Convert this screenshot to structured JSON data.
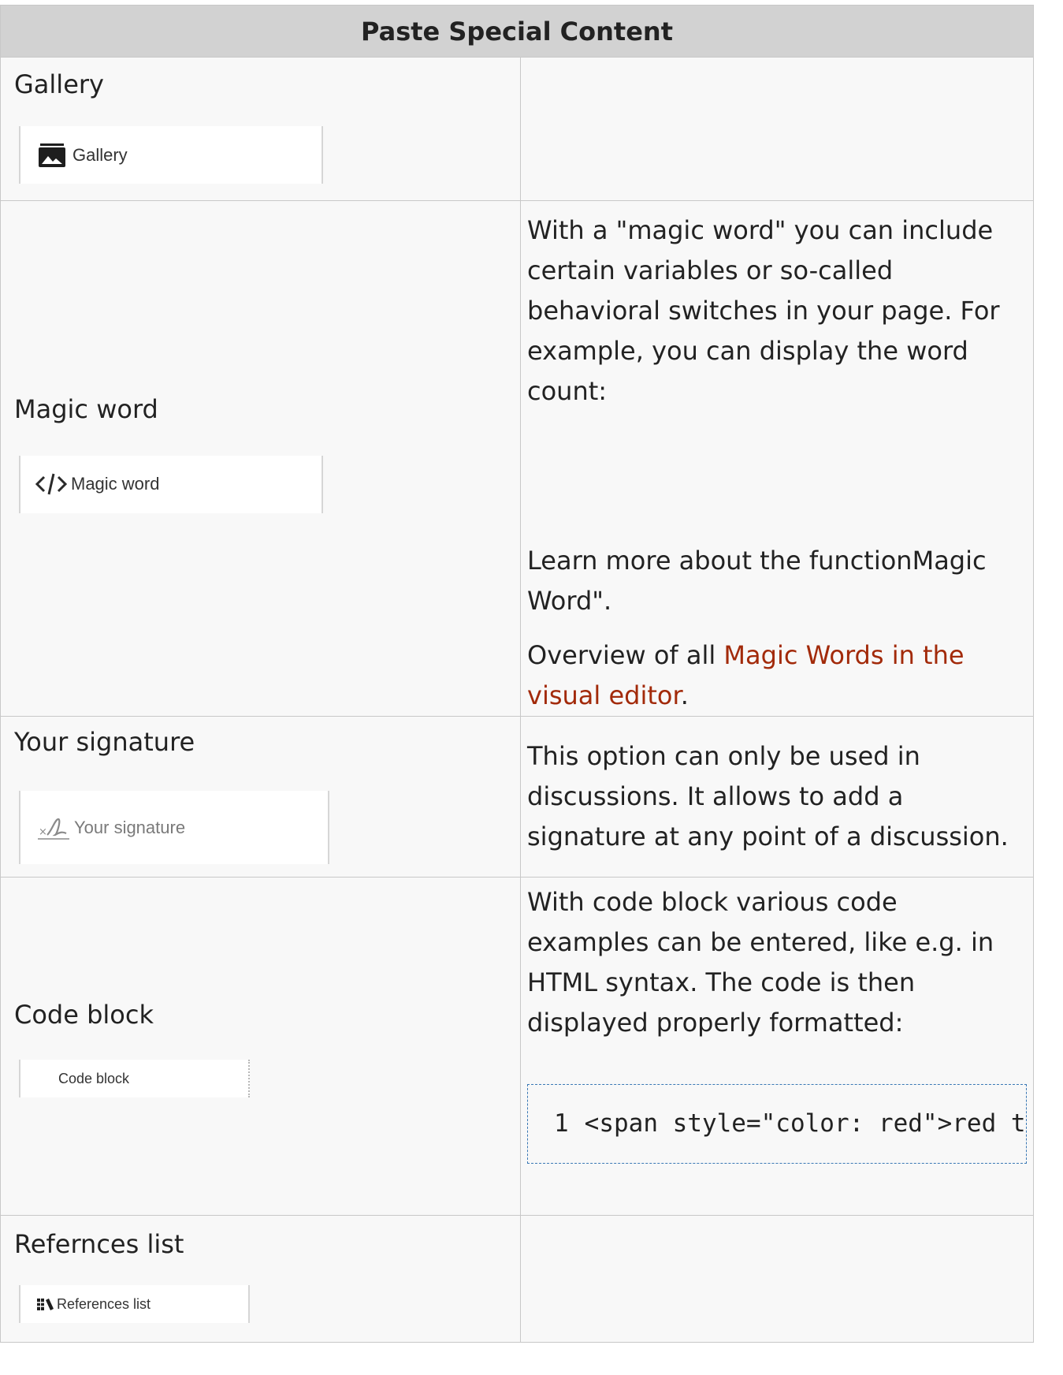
{
  "table": {
    "header": "Paste Special Content",
    "rows": [
      {
        "label": "Gallery",
        "button_text": "Gallery",
        "button_icon": "image-gallery-icon",
        "description": []
      },
      {
        "label": "Magic word",
        "button_text": "Magic word",
        "button_icon": "code-brackets-icon",
        "description": [
          "With a \"magic word\" you can include certain variables or so-called behavioral switches in your page. For example, you can display the word count:",
          "Learn more about the functionMagic Word\"."
        ],
        "overview_prefix": "Overview of all ",
        "overview_link": "Magic Words in the visual editor",
        "overview_suffix": "."
      },
      {
        "label": "Your signature",
        "button_text": "Your signature",
        "button_icon": "signature-icon",
        "description": [
          "This option can only be used in discussions. It allows to add a signature at any point of a discussion."
        ]
      },
      {
        "label": "Code block",
        "button_text": "Code block",
        "description": [
          "With code block various code examples can be entered, like e.g. in HTML syntax. The code is then displayed properly formatted:"
        ],
        "code_line_number": "1",
        "code_text": "<span style=\"color: red\">red text</span>"
      },
      {
        "label": "Refernces list",
        "button_text": "References list",
        "button_icon": "books-icon",
        "description": []
      }
    ]
  },
  "colors": {
    "header_bg": "#d2d2d2",
    "cell_bg": "#f8f8f8",
    "border": "#c8c8c8",
    "link": "#a22a0a",
    "code_border": "#3a78b5"
  }
}
